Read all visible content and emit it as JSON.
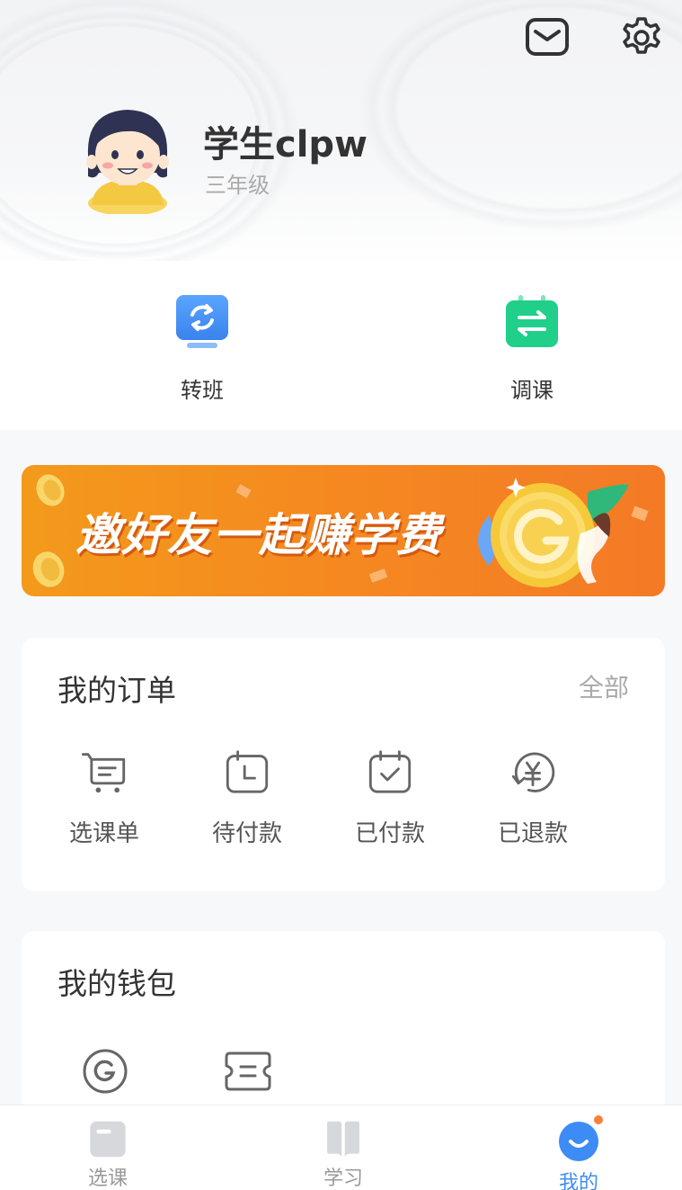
{
  "header": {
    "mail_icon": "mail-icon",
    "settings_icon": "gear-icon"
  },
  "profile": {
    "name": "学生clpw",
    "grade": "三年级"
  },
  "quick_actions": [
    {
      "label": "转班",
      "icon": "transfer-class-icon",
      "color": "#3d8cf5"
    },
    {
      "label": "调课",
      "icon": "adjust-course-icon",
      "color": "#1fcf8a"
    }
  ],
  "banner": {
    "text": "邀好友一起赚学费"
  },
  "orders": {
    "title": "我的订单",
    "more": "全部",
    "items": [
      {
        "label": "选课单",
        "icon": "cart-list-icon"
      },
      {
        "label": "待付款",
        "icon": "pending-clock-icon"
      },
      {
        "label": "已付款",
        "icon": "paid-calendar-check-icon"
      },
      {
        "label": "已退款",
        "icon": "refund-yen-icon"
      }
    ]
  },
  "wallet": {
    "title": "我的钱包",
    "items": [
      {
        "icon": "coin-g-icon"
      },
      {
        "icon": "coupon-ticket-icon"
      }
    ]
  },
  "tabbar": {
    "tabs": [
      {
        "label": "选课",
        "icon": "courses-tab-icon",
        "active": false
      },
      {
        "label": "学习",
        "icon": "study-book-icon",
        "active": false
      },
      {
        "label": "我的",
        "icon": "mine-smile-icon",
        "active": true
      }
    ],
    "active_color": "#3d8cf5",
    "badge_color": "#f7813a"
  }
}
